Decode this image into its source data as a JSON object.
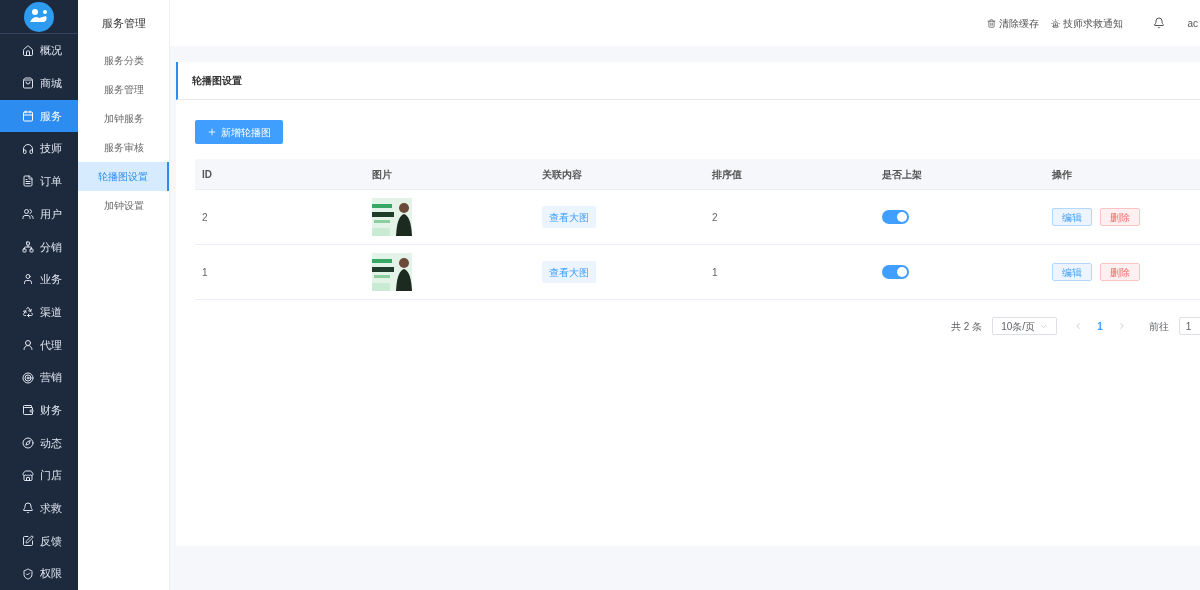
{
  "sidebar": {
    "items": [
      {
        "label": "概况",
        "selected": false
      },
      {
        "label": "商城",
        "selected": false
      },
      {
        "label": "服务",
        "selected": true
      },
      {
        "label": "技师",
        "selected": false
      },
      {
        "label": "订单",
        "selected": false
      },
      {
        "label": "用户",
        "selected": false
      },
      {
        "label": "分销",
        "selected": false
      },
      {
        "label": "业务",
        "selected": false
      },
      {
        "label": "渠道",
        "selected": false
      },
      {
        "label": "代理",
        "selected": false
      },
      {
        "label": "营销",
        "selected": false
      },
      {
        "label": "财务",
        "selected": false
      },
      {
        "label": "动态",
        "selected": false
      },
      {
        "label": "门店",
        "selected": false
      },
      {
        "label": "求救",
        "selected": false
      },
      {
        "label": "反馈",
        "selected": false
      },
      {
        "label": "权限",
        "selected": false
      }
    ]
  },
  "submenu": {
    "title": "服务管理",
    "items": [
      {
        "label": "服务分类",
        "selected": false
      },
      {
        "label": "服务管理",
        "selected": false
      },
      {
        "label": "加钟服务",
        "selected": false
      },
      {
        "label": "服务审核",
        "selected": false
      },
      {
        "label": "轮播图设置",
        "selected": true
      },
      {
        "label": "加钟设置",
        "selected": false
      }
    ]
  },
  "header": {
    "clear_cache": "清除缓存",
    "sos_notice": "技师求救通知",
    "user": "ac"
  },
  "page_title": "轮播图设置",
  "add_button": "新增轮播图",
  "table": {
    "columns": [
      "ID",
      "图片",
      "关联内容",
      "排序值",
      "是否上架",
      "操作"
    ],
    "rows": [
      {
        "id": "2",
        "link": "查看大图",
        "sort": "2",
        "on": true,
        "edit": "编辑",
        "delete": "删除"
      },
      {
        "id": "1",
        "link": "查看大图",
        "sort": "1",
        "on": true,
        "edit": "编辑",
        "delete": "删除"
      }
    ]
  },
  "pagination": {
    "total": "共 2 条",
    "page_size": "10条/页",
    "pages": [
      {
        "label": "1",
        "selected": true
      }
    ],
    "goto_label": "前往",
    "goto_value": "1"
  }
}
